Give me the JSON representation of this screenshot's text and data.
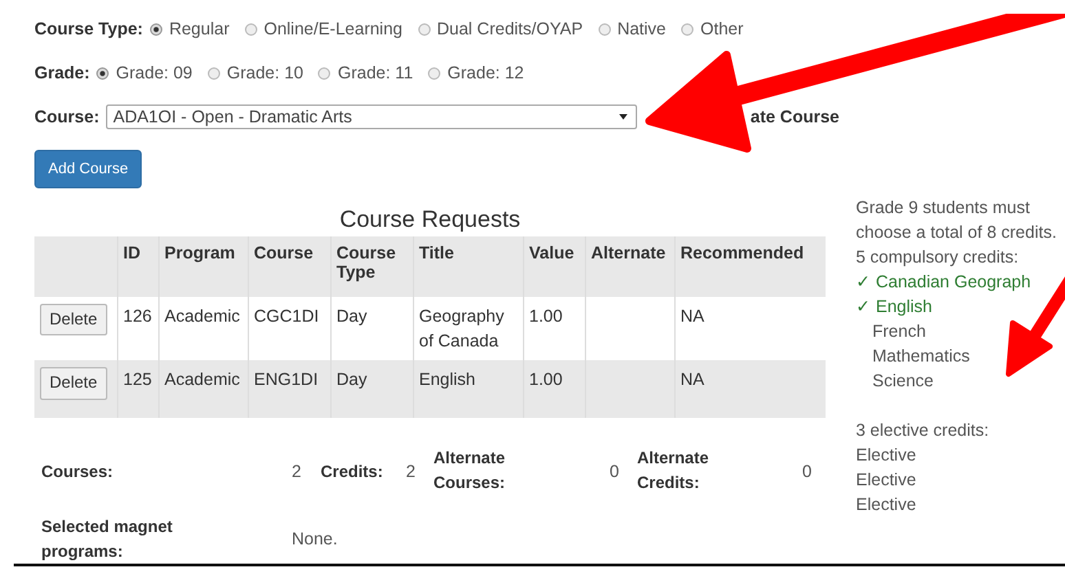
{
  "course_type": {
    "label": "Course Type:",
    "options": [
      {
        "label": "Regular",
        "selected": true
      },
      {
        "label": "Online/E-Learning",
        "selected": false
      },
      {
        "label": "Dual Credits/OYAP",
        "selected": false
      },
      {
        "label": "Native",
        "selected": false
      },
      {
        "label": "Other",
        "selected": false
      }
    ]
  },
  "grade": {
    "label": "Grade:",
    "options": [
      {
        "label": "Grade: 09",
        "selected": true
      },
      {
        "label": "Grade: 10",
        "selected": false
      },
      {
        "label": "Grade: 11",
        "selected": false
      },
      {
        "label": "Grade: 12",
        "selected": false
      }
    ]
  },
  "course": {
    "label": "Course:",
    "value": "ADA1OI - Open - Dramatic Arts"
  },
  "alternate_course": {
    "label": "ate Course"
  },
  "add_button": "Add Course",
  "table": {
    "title": "Course Requests",
    "columns": [
      "",
      "ID",
      "Program",
      "Course",
      "Course Type",
      "Title",
      "Value",
      "Alternate",
      "Recommended"
    ],
    "rows": [
      {
        "cells": [
          "Delete",
          "126",
          "Academic",
          "CGC1DI",
          "Day",
          "Geography of Canada",
          "1.00",
          "",
          "NA"
        ]
      },
      {
        "cells": [
          "Delete",
          "125",
          "Academic",
          "ENG1DI",
          "Day",
          "English",
          "1.00",
          "",
          "NA"
        ]
      }
    ]
  },
  "summary": {
    "items": [
      {
        "label": "Courses:",
        "value": "2"
      },
      {
        "label": "Credits:",
        "value": "2"
      },
      {
        "label": "Alternate Courses:",
        "value": "0"
      },
      {
        "label": "Alternate Credits:",
        "value": "0"
      }
    ],
    "magnet": {
      "label": "Selected magnet programs:",
      "value": "None."
    }
  },
  "sidebar": {
    "intro": "Grade 9 students must choose a total of 8 credits.",
    "compulsory_heading": "5 compulsory credits:",
    "compulsory": [
      {
        "label": "Canadian Geograph",
        "done": true
      },
      {
        "label": "English",
        "done": true
      },
      {
        "label": "French",
        "done": false
      },
      {
        "label": "Mathematics",
        "done": false
      },
      {
        "label": "Science",
        "done": false
      }
    ],
    "check_mark": "✓",
    "elective_heading": "3 elective credits:",
    "electives": [
      "Elective",
      "Elective",
      "Elective"
    ]
  }
}
